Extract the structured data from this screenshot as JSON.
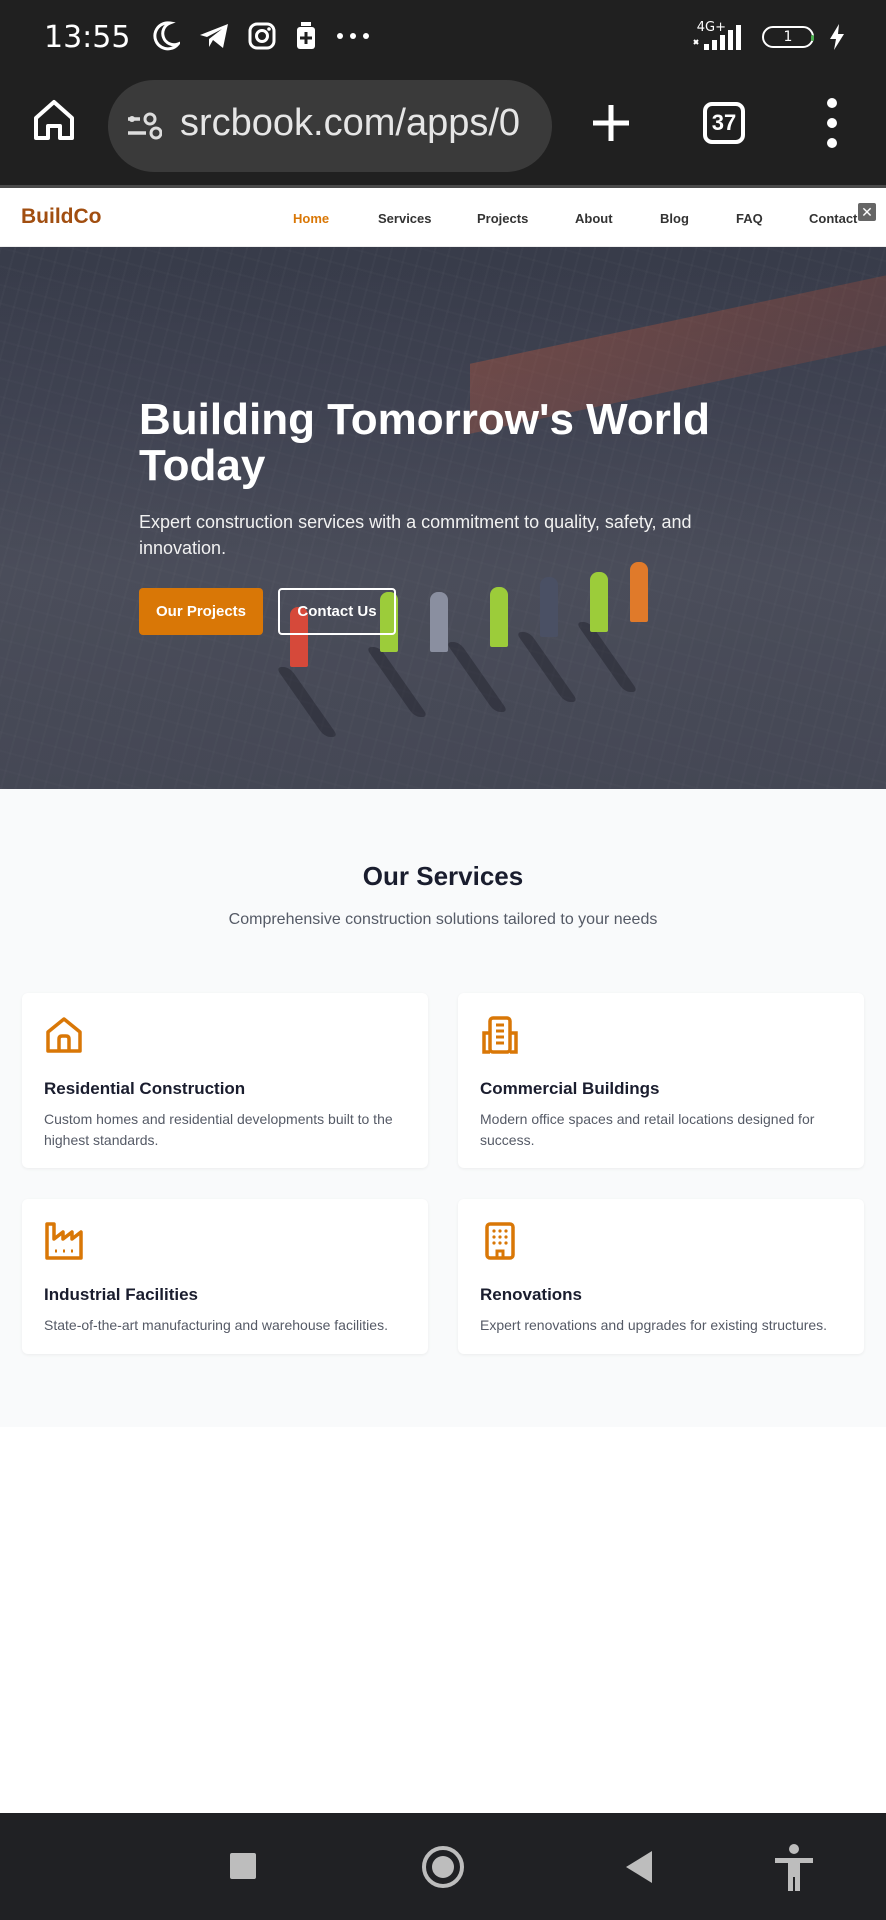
{
  "status_bar": {
    "time": "13:55",
    "network": "4G+",
    "battery": "1",
    "icons_left": [
      "moon-icon",
      "telegram-icon",
      "instagram-icon",
      "sim-icon",
      "more-icon"
    ],
    "icons_right": [
      "signal-icon",
      "battery-icon",
      "charging-icon"
    ]
  },
  "browser": {
    "url": "srcbook.com/apps/0",
    "tab_count": "37"
  },
  "site": {
    "brand": "BuildCo",
    "nav": [
      "Home",
      "Services",
      "Projects",
      "About",
      "Blog",
      "FAQ",
      "Contact"
    ],
    "active_nav": "Home",
    "accent_color": "#d97706",
    "brand_color": "#a14e10"
  },
  "hero": {
    "title": "Building Tomorrow's World Today",
    "subtitle": "Expert construction services with a commitment to quality, safety, and innovation.",
    "primary_button": "Our Projects",
    "secondary_button": "Contact Us"
  },
  "services": {
    "title": "Our Services",
    "subtitle": "Comprehensive construction solutions tailored to your needs",
    "cards": [
      {
        "icon": "home-icon",
        "title": "Residential Construction",
        "description": "Custom homes and residential developments built to the highest standards."
      },
      {
        "icon": "office-building-icon",
        "title": "Commercial Buildings",
        "description": "Modern office spaces and retail locations designed for success."
      },
      {
        "icon": "factory-icon",
        "title": "Industrial Facilities",
        "description": "State-of-the-art manufacturing and warehouse facilities."
      },
      {
        "icon": "building-icon",
        "title": "Renovations",
        "description": "Expert renovations and upgrades for existing structures."
      }
    ]
  }
}
